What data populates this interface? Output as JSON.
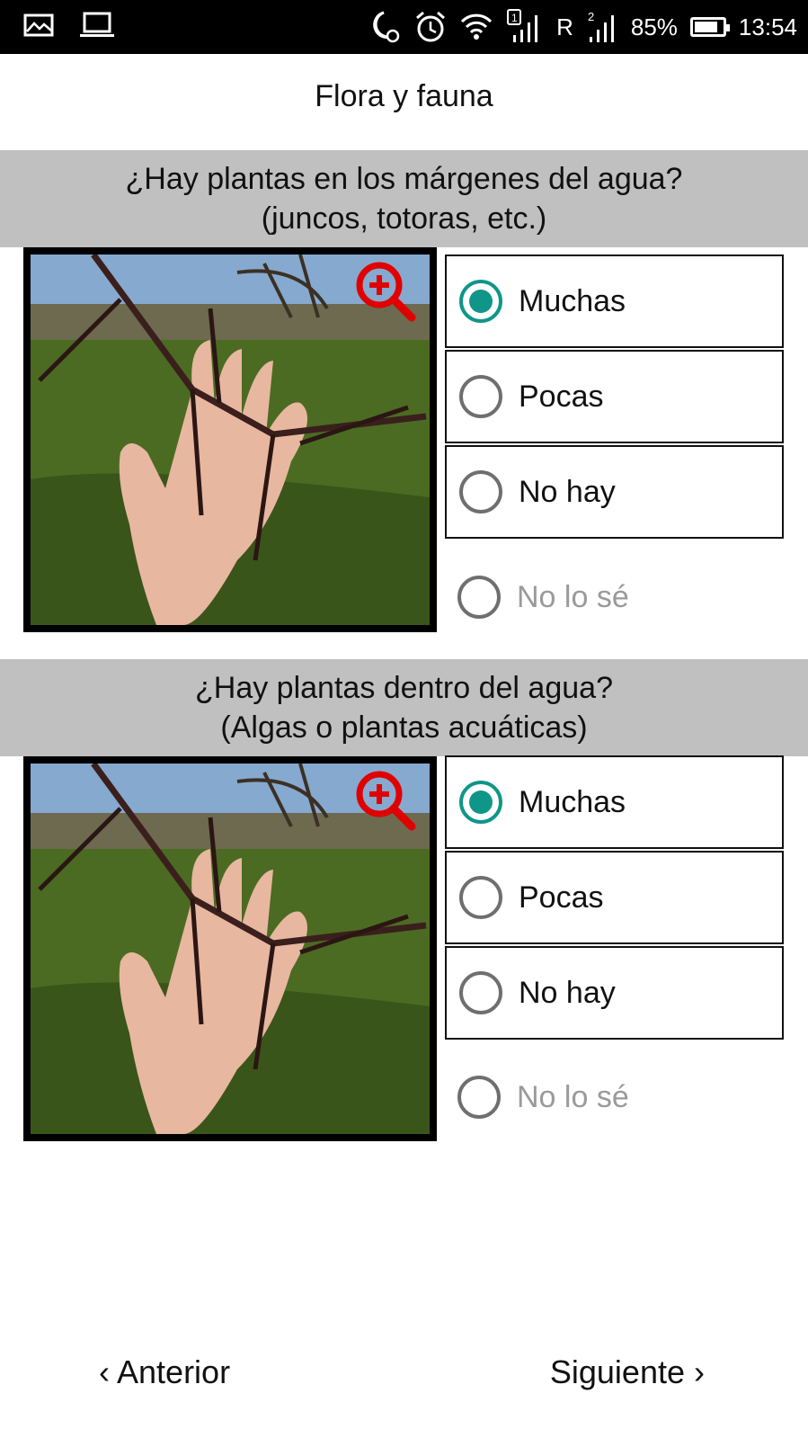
{
  "status": {
    "battery": "85%",
    "time": "13:54",
    "carrier_letter": "R",
    "battery_level": 0.85,
    "icons": [
      "gallery-icon",
      "laptop-icon",
      "night-alarm-icon",
      "alarm-icon",
      "wifi-icon",
      "signal-sim1-icon",
      "signal-sim2-icon",
      "battery-icon"
    ]
  },
  "page": {
    "title": "Flora y fauna"
  },
  "questions": [
    {
      "line1": "¿Hay plantas en los márgenes del agua?",
      "line2": "(juncos, totoras, etc.)",
      "options": [
        "Muchas",
        "Pocas",
        "No hay",
        "No lo sé"
      ],
      "selected": "Muchas"
    },
    {
      "line1": "¿Hay plantas dentro del agua?",
      "line2": "(Algas o plantas acuáticas)",
      "options": [
        "Muchas",
        "Pocas",
        "No hay",
        "No lo sé"
      ],
      "selected": "Muchas"
    }
  ],
  "nav": {
    "prev": "Anterior",
    "next": "Siguiente"
  },
  "colors": {
    "accent": "#0f9688",
    "header_bg": "#c0c0c0",
    "zoom_icon": "#e00000"
  }
}
